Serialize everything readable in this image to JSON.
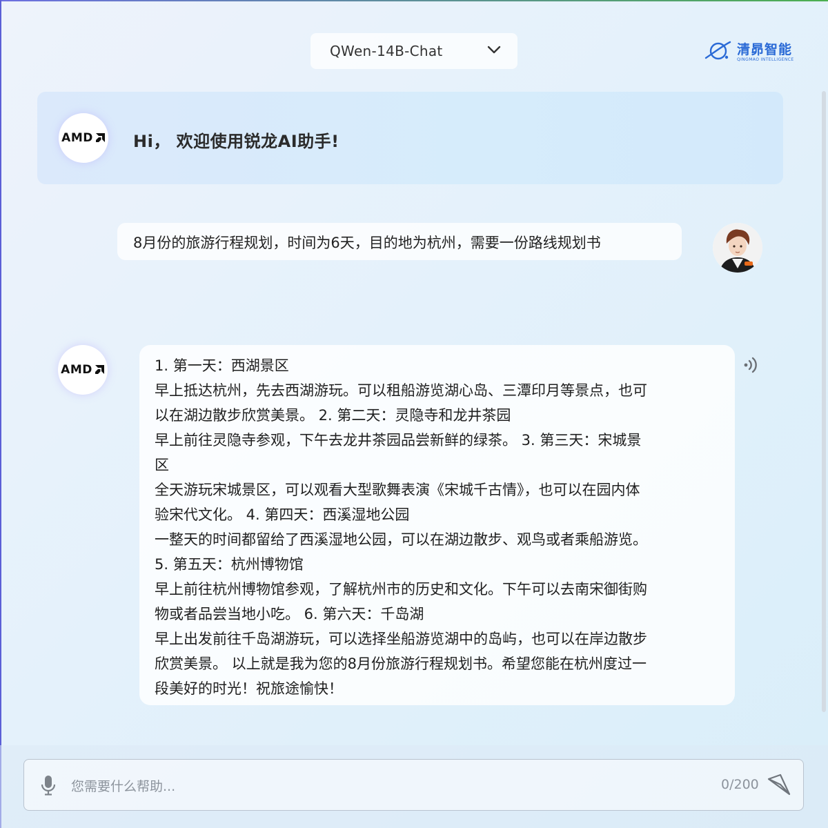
{
  "header": {
    "model_selected": "QWen-14B-Chat",
    "brand_name": "清昴智能",
    "brand_sub": "QINGMAO INTELLIGENCE"
  },
  "welcome": {
    "avatar_logo": "AMD",
    "text": "Hi， 欢迎使用锐龙AI助手!"
  },
  "conversation": {
    "user_message": "8月份的旅游行程规划，时间为6天，目的地为杭州，需要一份路线规划书",
    "assistant_avatar_logo": "AMD",
    "assistant_lines": [
      "1. 第一天：西湖景区",
      "早上抵达杭州，先去西湖游玩。可以租船游览湖心岛、三潭印月等景点，也可",
      "以在湖边散步欣赏美景。 2. 第二天：灵隐寺和龙井茶园",
      "早上前往灵隐寺参观，下午去龙井茶园品尝新鲜的绿茶。 3. 第三天：宋城景",
      "区",
      "全天游玩宋城景区，可以观看大型歌舞表演《宋城千古情》，也可以在园内体",
      "验宋代文化。 4. 第四天：西溪湿地公园",
      "一整天的时间都留给了西溪湿地公园，可以在湖边散步、观鸟或者乘船游览。",
      "5. 第五天：杭州博物馆",
      "早上前往杭州博物馆参观，了解杭州市的历史和文化。下午可以去南宋御街购",
      "物或者品尝当地小吃。 6. 第六天：千岛湖",
      "早上出发前往千岛湖游玩，可以选择坐船游览湖中的岛屿，也可以在岸边散步",
      "欣赏美景。 以上就是我为您的8月份旅游行程规划书。希望您能在杭州度过一",
      "段美好的时光！祝旅途愉快！"
    ]
  },
  "input": {
    "placeholder": "您需要什么帮助...",
    "counter": "0/200"
  },
  "icons": {
    "select": "chevron-down-icon",
    "speaker": "speaker-icon",
    "mic": "microphone-icon",
    "send": "send-icon"
  },
  "colors": {
    "brand_blue": "#2a6ad6",
    "amd_red": "#e4572e"
  }
}
